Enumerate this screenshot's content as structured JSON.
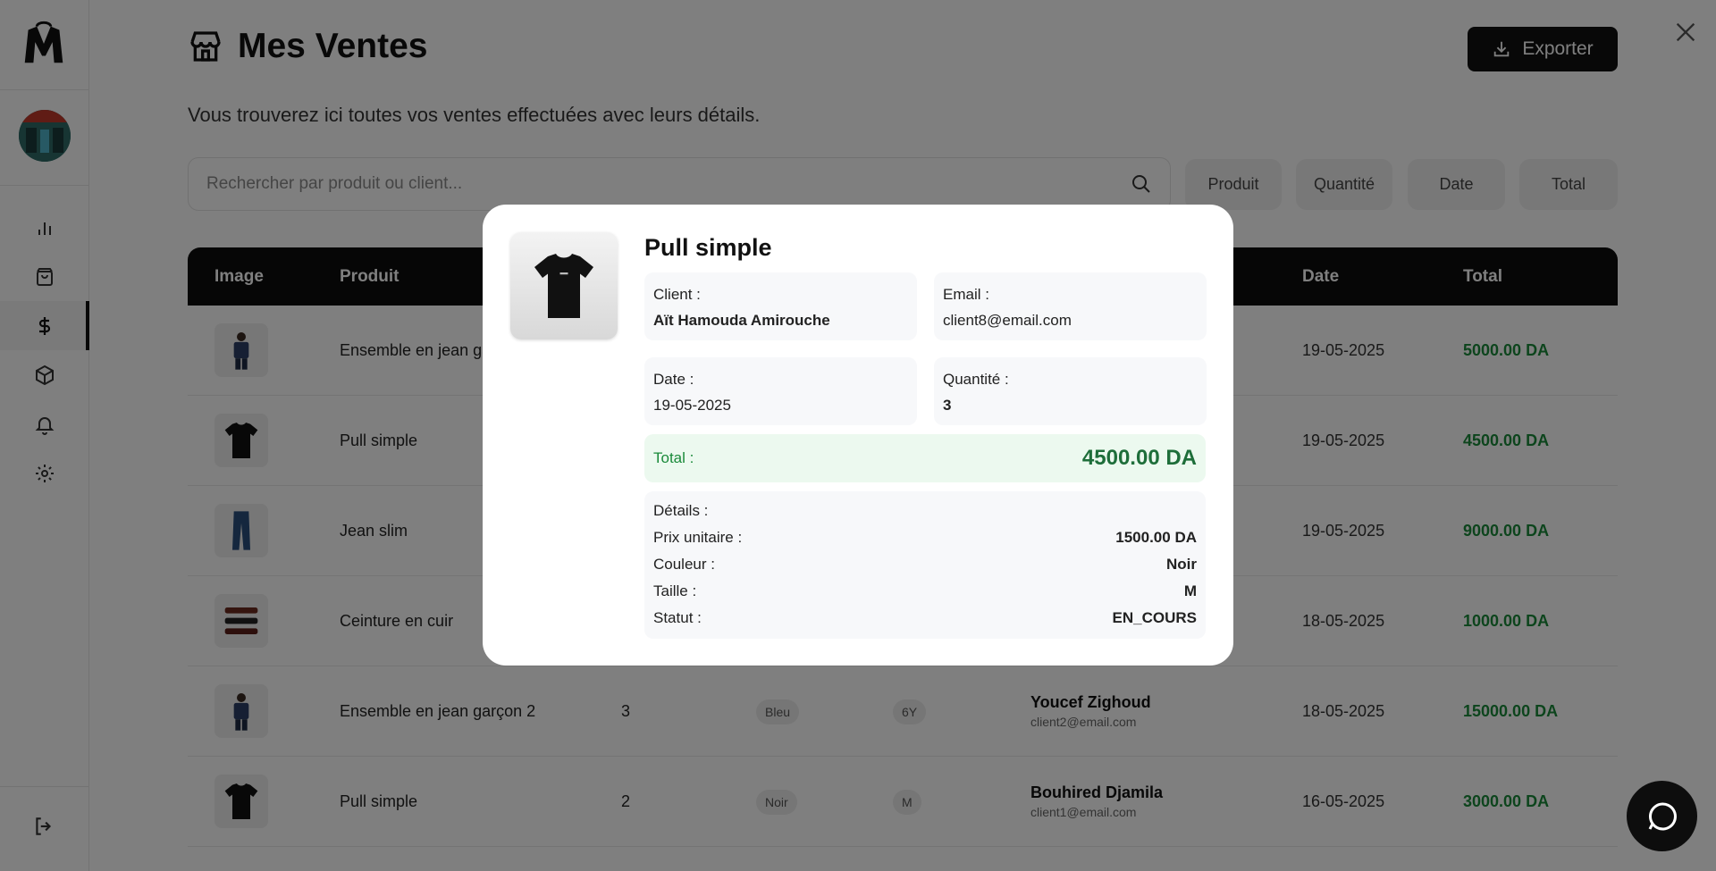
{
  "page": {
    "title": "Mes Ventes",
    "subtitle": "Vous trouverez ici toutes vos ventes effectuées avec leurs détails.",
    "export_label": "Exporter",
    "search_placeholder": "Rechercher par produit ou client..."
  },
  "filters": [
    "Produit",
    "Quantité",
    "Date",
    "Total"
  ],
  "table": {
    "headers": {
      "image": "Image",
      "product": "Produit",
      "date": "Date",
      "total": "Total"
    },
    "rows": [
      {
        "product": "Ensemble en jean garçon",
        "qty": "",
        "color": "",
        "size": "",
        "client": "",
        "email": "",
        "date": "19-05-2025",
        "total": "5000.00 DA",
        "img": "kid-icon"
      },
      {
        "product": "Pull simple",
        "qty": "",
        "color": "",
        "size": "",
        "client": "",
        "email": "",
        "date": "19-05-2025",
        "total": "4500.00 DA",
        "img": "tshirt-icon"
      },
      {
        "product": "Jean slim",
        "qty": "",
        "color": "",
        "size": "",
        "client": "",
        "email": "",
        "date": "19-05-2025",
        "total": "9000.00 DA",
        "img": "jeans-icon"
      },
      {
        "product": "Ceinture en cuir",
        "qty": "",
        "color": "",
        "size": "",
        "client": "",
        "email": "",
        "date": "18-05-2025",
        "total": "1000.00 DA",
        "img": "belt-icon"
      },
      {
        "product": "Ensemble en jean garçon 2",
        "qty": "3",
        "color": "Bleu",
        "size": "6Y",
        "client": "Youcef Zighoud",
        "email": "client2@email.com",
        "date": "18-05-2025",
        "total": "15000.00 DA",
        "img": "kid-icon"
      },
      {
        "product": "Pull simple",
        "qty": "2",
        "color": "Noir",
        "size": "M",
        "client": "Bouhired Djamila",
        "email": "client1@email.com",
        "date": "16-05-2025",
        "total": "3000.00 DA",
        "img": "tshirt-icon"
      }
    ]
  },
  "modal": {
    "title": "Pull simple",
    "client_label": "Client :",
    "client_value": "Aït Hamouda Amirouche",
    "email_label": "Email :",
    "email_value": "client8@email.com",
    "date_label": "Date :",
    "date_value": "19-05-2025",
    "qty_label": "Quantité :",
    "qty_value": "3",
    "total_label": "Total :",
    "total_value": "4500.00 DA",
    "details_title": "Détails :",
    "details": [
      {
        "label": "Prix unitaire :",
        "value": "1500.00 DA"
      },
      {
        "label": "Couleur :",
        "value": "Noir"
      },
      {
        "label": "Taille :",
        "value": "M"
      },
      {
        "label": "Statut :",
        "value": "EN_COURS"
      }
    ]
  },
  "colors": {
    "accent_green": "#1a8a3a",
    "dark": "#0d0d0d",
    "overlay": "rgba(0,0,0,0.5)"
  }
}
